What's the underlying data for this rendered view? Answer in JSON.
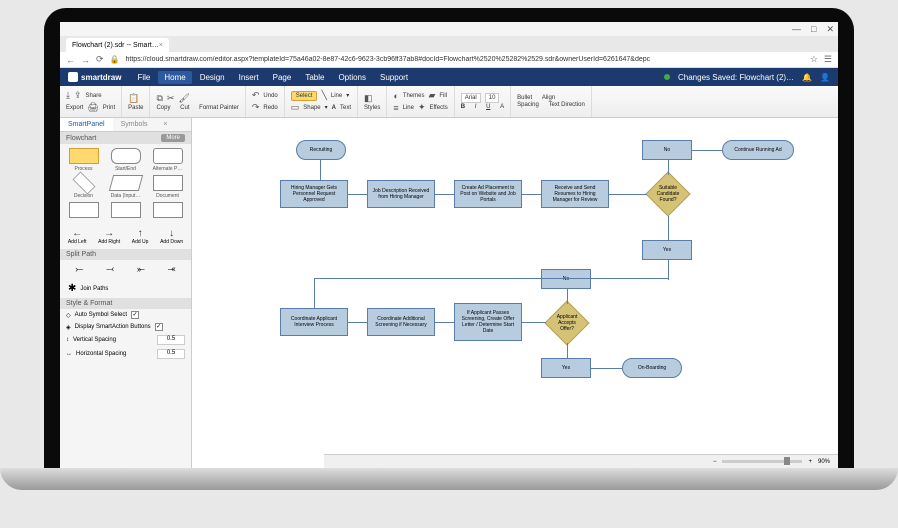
{
  "browser": {
    "tab_title": "Flowchart (2).sdr -- Smart…",
    "url": "https://cloud.smartdraw.com/editor.aspx?templateId=75a46a02-8e87-42c6-9623-3cb96ff37ab8#docId=Flowchart%2520%25282%2529.sdr&ownerUserId=6261647&depc"
  },
  "app": {
    "brand": "smartdraw",
    "status": "Changes Saved: Flowchart (2)…"
  },
  "menu": [
    "File",
    "Home",
    "Design",
    "Insert",
    "Page",
    "Table",
    "Options",
    "Support"
  ],
  "ribbon": {
    "export": "Export",
    "share": "Share",
    "print": "Print",
    "paste": "Paste",
    "copy": "Copy",
    "cut": "Cut",
    "format_painter": "Format Painter",
    "undo": "Undo",
    "redo": "Redo",
    "select": "Select",
    "shape": "Shape",
    "line": "Line",
    "text": "Text",
    "styles": "Styles",
    "line_tool": "Line",
    "fill": "Fill",
    "themes": "Themes",
    "effects": "Effects",
    "font_name": "Arial",
    "font_size": "10",
    "bullet": "Bullet",
    "align": "Align",
    "spacing": "Spacing",
    "direction": "Text Direction"
  },
  "panel": {
    "tabs": [
      "SmartPanel",
      "Symbols"
    ],
    "section": "Flowchart",
    "more": "More",
    "shapes": [
      "Process",
      "Start/End",
      "Alternate P…",
      "Decision",
      "Data (Input…",
      "Document"
    ],
    "arrows": [
      "Add Left",
      "Add Right",
      "Add Up",
      "Add Down"
    ],
    "split_head": "Split Path",
    "join": "Join Paths",
    "style_head": "Style & Format",
    "auto_symbol": "Auto Symbol Select",
    "smart_action": "Display SmartAction Buttons",
    "vspace": "Vertical Spacing",
    "vspace_val": "0.5",
    "hspace": "Horizontal Spacing",
    "hspace_val": "0.5"
  },
  "flow": {
    "recruiting": "Recruiting",
    "n1": "Hiring Manager Gets Personnel Request Approved",
    "n2": "Job Description Received from Hiring Manager",
    "n3": "Create Ad Placement to Post on Website and Job Portals",
    "n4": "Receive and Send Resumes to Hiring Manager for Review",
    "d1": "Suitable Candidate Found?",
    "no1": "No",
    "continue": "Continue Running Ad",
    "yes1": "Yes",
    "n5": "Coordinate Applicant Interview Process",
    "n6": "Coordinate Additional Screening if Necessary",
    "n7": "If Applicant Passes Screening, Create Offer Letter / Determine Start Date",
    "d2": "Applicant Accepts Offer?",
    "no2": "No",
    "yes2": "Yes",
    "onboard": "On-Boarding"
  },
  "zoom": "90%"
}
